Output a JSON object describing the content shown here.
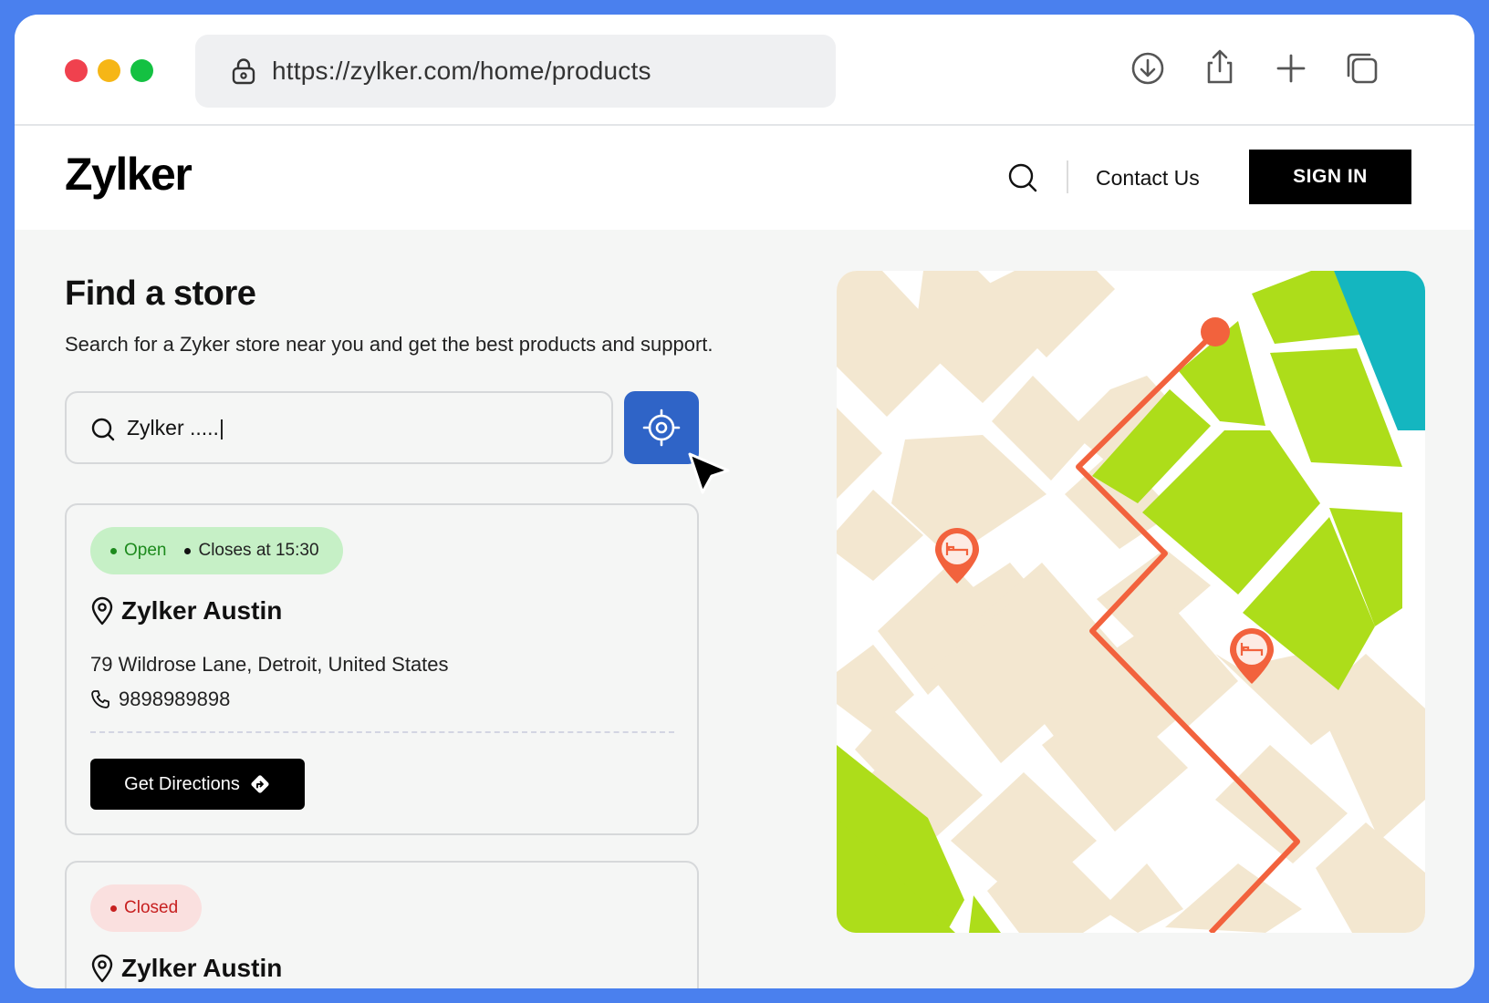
{
  "browser": {
    "url": "https://zylker.com/home/products",
    "toolbar_icons": [
      "download-icon",
      "share-icon",
      "plus-icon",
      "tabs-icon"
    ]
  },
  "header": {
    "logo": "Zylker",
    "contact_label": "Contact Us",
    "signin_label": "SIGN IN"
  },
  "main": {
    "title": "Find a store",
    "subtitle": "Search for a Zyker store near you and get the best products and support.",
    "search_value": "Zylker .....|"
  },
  "stores": [
    {
      "status": "Open",
      "hours": "Closes at 15:30",
      "name": "Zylker Austin",
      "address": "79 Wildrose Lane, Detroit, United States",
      "phone": "9898989898",
      "directions_label": "Get Directions"
    },
    {
      "status": "Closed",
      "name": "Zylker Austin"
    }
  ],
  "colors": {
    "accent_blue": "#2f64c7",
    "frame_blue": "#4a80ee",
    "open_green": "#1d8a1d",
    "closed_red": "#c72020",
    "route_orange": "#f2623d",
    "park_green": "#addd1a",
    "block_beige": "#f3e7d0",
    "water_teal": "#14b6c0"
  }
}
